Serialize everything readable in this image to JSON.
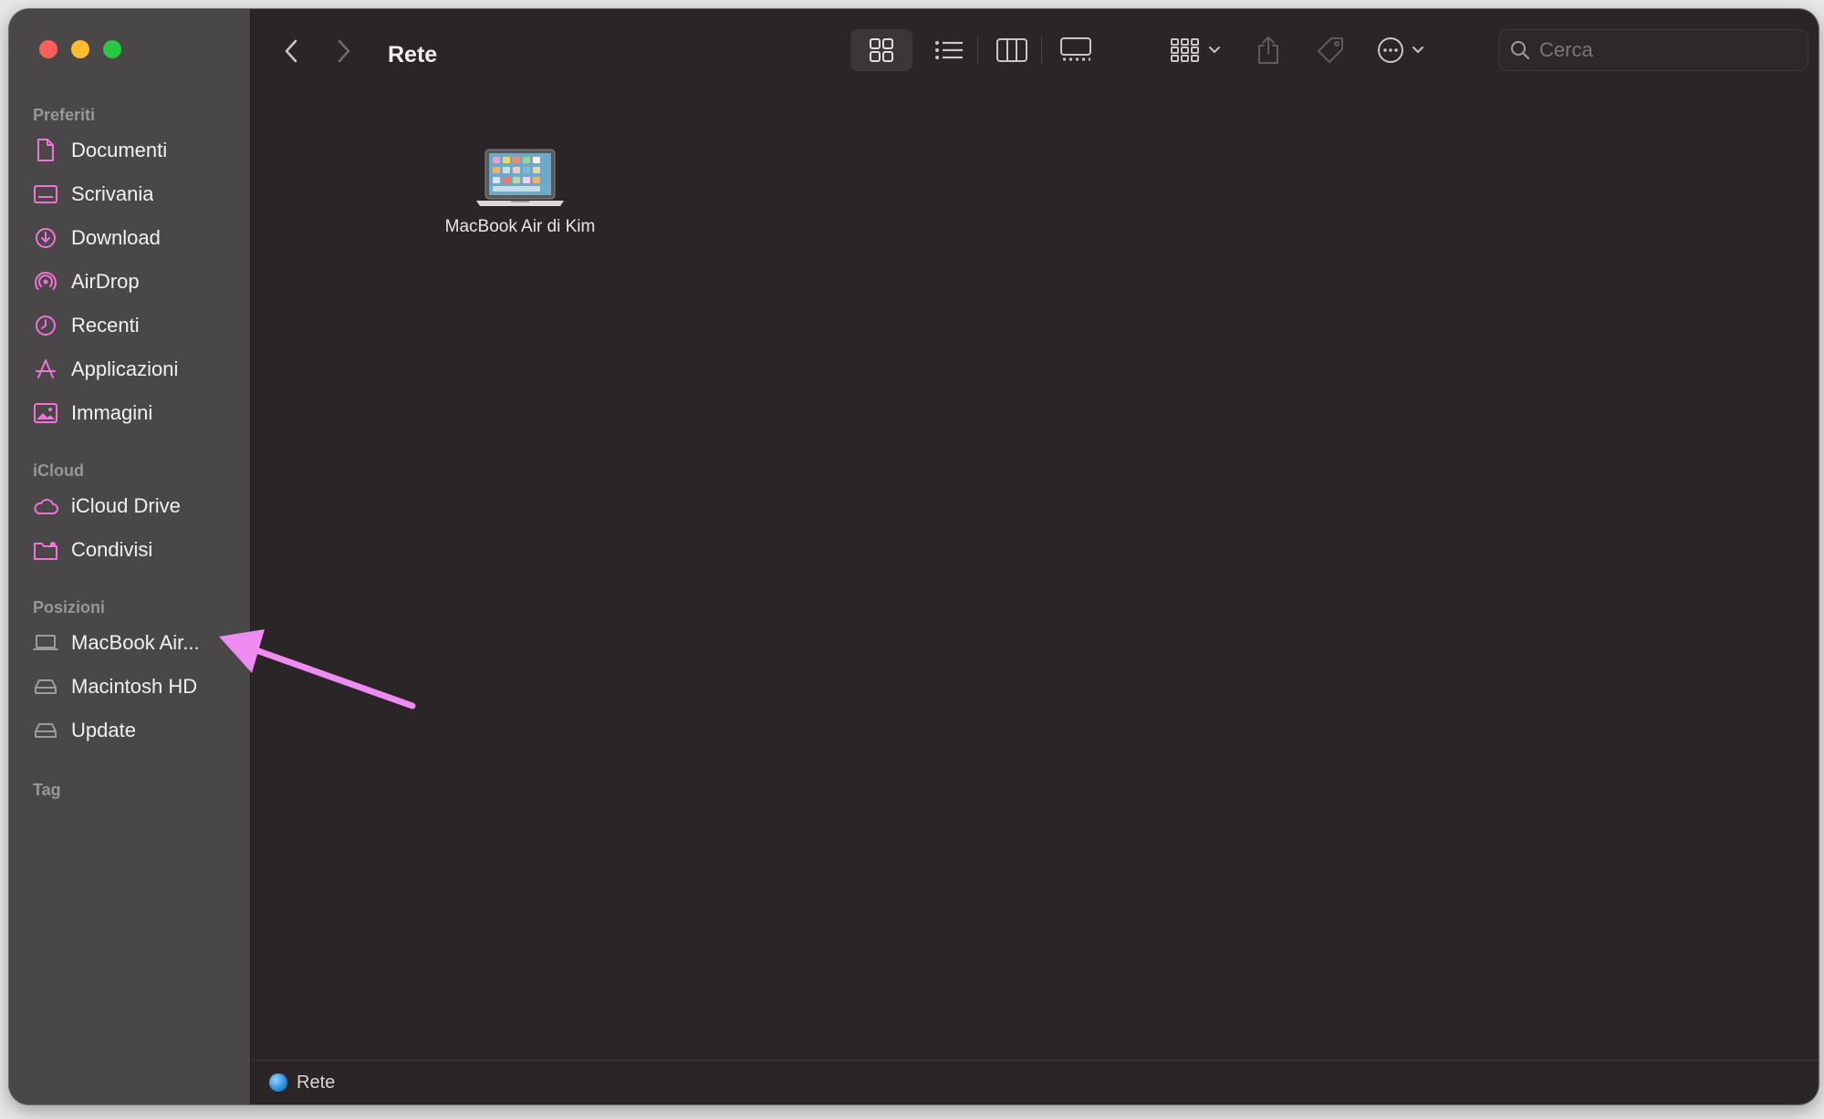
{
  "window": {
    "title": "Rete",
    "traffic_lights": [
      "#fe5f57",
      "#febc2e",
      "#28c840"
    ]
  },
  "sidebar": {
    "sections": [
      {
        "header": "Preferiti",
        "items": [
          {
            "label": "Documenti",
            "icon": "document-icon"
          },
          {
            "label": "Scrivania",
            "icon": "desktop-icon"
          },
          {
            "label": "Download",
            "icon": "download-icon"
          },
          {
            "label": "AirDrop",
            "icon": "airdrop-icon"
          },
          {
            "label": "Recenti",
            "icon": "clock-icon"
          },
          {
            "label": "Applicazioni",
            "icon": "applications-icon"
          },
          {
            "label": "Immagini",
            "icon": "photo-icon"
          }
        ]
      },
      {
        "header": "iCloud",
        "items": [
          {
            "label": "iCloud Drive",
            "icon": "cloud-icon"
          },
          {
            "label": "Condivisi",
            "icon": "shared-folder-icon"
          }
        ]
      },
      {
        "header": "Posizioni",
        "items": [
          {
            "label": "MacBook Air...",
            "icon": "laptop-icon"
          },
          {
            "label": "Macintosh HD",
            "icon": "disk-icon"
          },
          {
            "label": "Update",
            "icon": "disk-icon"
          }
        ]
      },
      {
        "header": "Tag",
        "items": []
      }
    ],
    "accent_color": "#f074d6"
  },
  "toolbar": {
    "search_placeholder": "Cerca"
  },
  "content": {
    "items": [
      {
        "label": "MacBook Air di Kim",
        "icon": "macbook-icon"
      }
    ]
  },
  "statusbar": {
    "path": "Rete"
  },
  "annotation": {
    "arrow_color": "#ee8cf2"
  }
}
